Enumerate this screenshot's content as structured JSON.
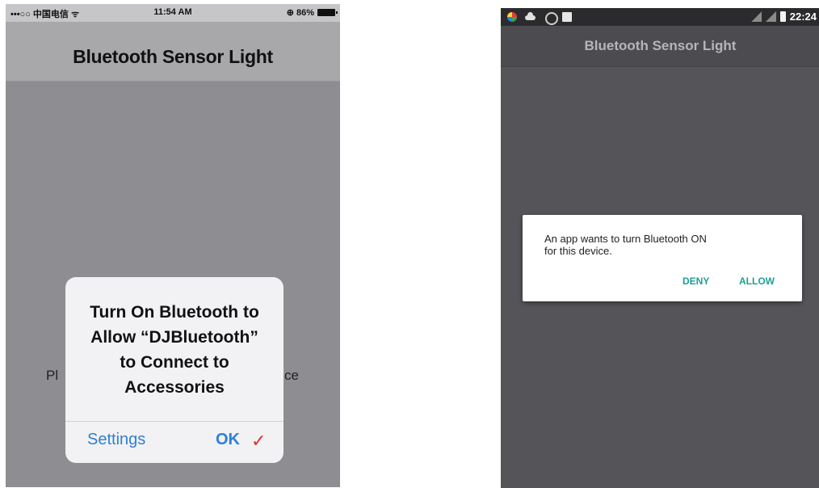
{
  "ios": {
    "status_bar": {
      "carrier": "•••○○ 中国电信 ᯤ",
      "time": "11:54 AM",
      "battery": "⊕ 86%"
    },
    "nav_title": "Bluetooth Sensor Light",
    "background_text_left": "Pl",
    "background_text_right": "ce",
    "alert": {
      "message_lines": [
        "Turn On Bluetooth to",
        "Allow “DJBluetooth”",
        "to Connect to",
        "Accessories"
      ],
      "settings_label": "Settings",
      "ok_label": "OK",
      "check_mark": "✓"
    }
  },
  "android": {
    "status_bar": {
      "time": "22:24",
      "icons": [
        "app-icon",
        "cloud-icon",
        "sync-icon",
        "image-icon",
        "signal-icon",
        "signal-icon",
        "battery-icon"
      ]
    },
    "title": "Bluetooth Sensor Light",
    "dialog": {
      "message_lines": [
        "An app wants to turn Bluetooth ON",
        "for this device."
      ],
      "deny_label": "DENY",
      "allow_label": "ALLOW"
    }
  },
  "colors": {
    "ios_link_blue": "#2f7fd8",
    "check_red": "#e0322a",
    "android_accent_teal": "#1e9f96"
  }
}
